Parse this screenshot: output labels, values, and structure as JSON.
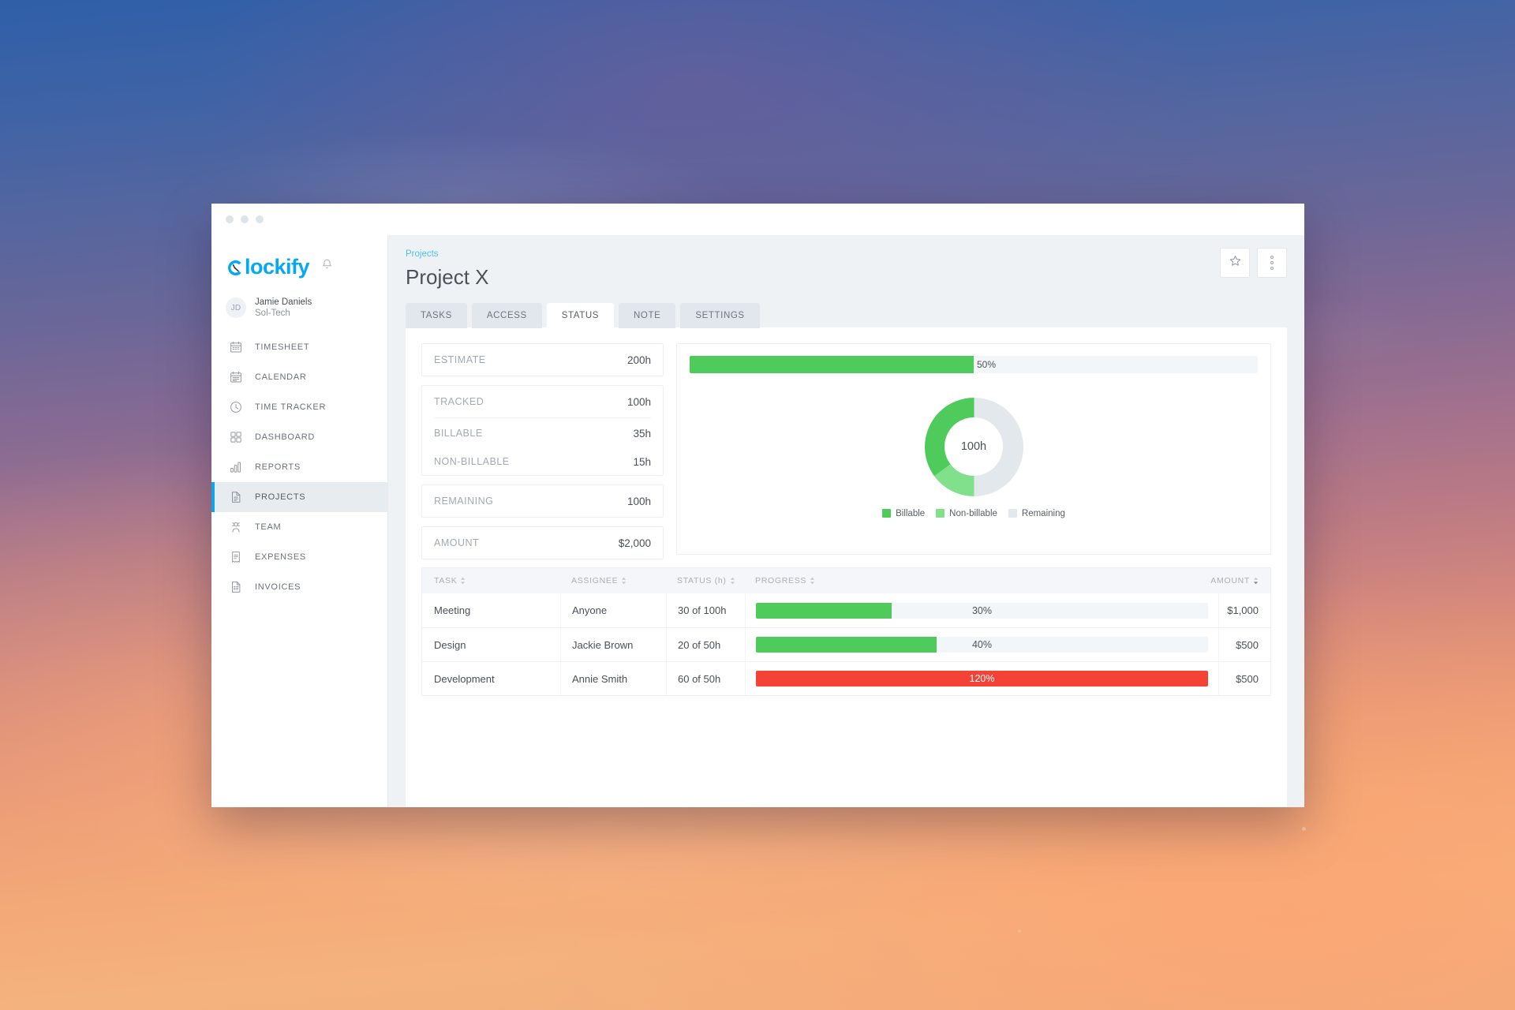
{
  "window": {
    "controls": [
      "close",
      "minimize",
      "maximize"
    ]
  },
  "sidebar": {
    "brand": "lockify",
    "bell_icon": "bell-icon",
    "user": {
      "initials": "JD",
      "name": "Jamie Daniels",
      "org": "Sol-Tech"
    },
    "items": [
      {
        "label": "TIMESHEET",
        "icon": "calendar-grid-icon",
        "active": false
      },
      {
        "label": "CALENDAR",
        "icon": "calendar-lines-icon",
        "active": false
      },
      {
        "label": "TIME TRACKER",
        "icon": "clock-icon",
        "active": false
      },
      {
        "label": "DASHBOARD",
        "icon": "grid-squares-icon",
        "active": false
      },
      {
        "label": "REPORTS",
        "icon": "bar-chart-icon",
        "active": false
      },
      {
        "label": "PROJECTS",
        "icon": "document-icon",
        "active": true
      },
      {
        "label": "TEAM",
        "icon": "people-icon",
        "active": false
      },
      {
        "label": "EXPENSES",
        "icon": "receipt-icon",
        "active": false
      },
      {
        "label": "INVOICES",
        "icon": "invoice-icon",
        "active": false
      }
    ]
  },
  "header": {
    "breadcrumb": "Projects",
    "title": "Project X",
    "favorite_icon": "star-icon",
    "menu_icon": "kebab-menu-icon"
  },
  "tabs": [
    {
      "label": "TASKS",
      "active": false
    },
    {
      "label": "ACCESS",
      "active": false
    },
    {
      "label": "STATUS",
      "active": true
    },
    {
      "label": "NOTE",
      "active": false
    },
    {
      "label": "SETTINGS",
      "active": false
    }
  ],
  "stats": {
    "estimate": {
      "label": "ESTIMATE",
      "value": "200h"
    },
    "tracked": {
      "label": "TRACKED",
      "value": "100h"
    },
    "billable": {
      "label": "BILLABLE",
      "value": "35h"
    },
    "non_billable": {
      "label": "NON-BILLABLE",
      "value": "15h"
    },
    "remaining": {
      "label": "REMAINING",
      "value": "100h"
    },
    "amount": {
      "label": "AMOUNT",
      "value": "$2,000"
    }
  },
  "colors": {
    "green": "#4ecb5a",
    "light_green": "#81e08b",
    "gray": "#e3e8ec",
    "red": "#f44336",
    "accent_blue": "#03a9f4",
    "breadcrumb_blue": "#4fc0f0"
  },
  "chart_data": {
    "type": "pie",
    "title": "",
    "center_label": "100h",
    "overall_progress": {
      "percent": 50,
      "label": "50%"
    },
    "labels": [
      "Billable",
      "Non-billable",
      "Remaining"
    ],
    "values": [
      35,
      15,
      50
    ],
    "units": "h",
    "colors": [
      "#4ecb5a",
      "#81e08b",
      "#e3e8ec"
    ],
    "legend_position": "bottom",
    "total": 200
  },
  "table": {
    "columns": [
      {
        "label": "TASK",
        "sort": "none"
      },
      {
        "label": "ASSIGNEE",
        "sort": "none"
      },
      {
        "label": "STATUS (h)",
        "sort": "none"
      },
      {
        "label": "PROGRESS",
        "sort": "none"
      },
      {
        "label": "AMOUNT",
        "sort": "desc"
      }
    ],
    "rows": [
      {
        "task": "Meeting",
        "assignee": "Anyone",
        "status": "30 of 100h",
        "progress_label": "30%",
        "progress_pct": 30,
        "over": false,
        "amount": "$1,000"
      },
      {
        "task": "Design",
        "assignee": "Jackie Brown",
        "status": "20 of 50h",
        "progress_label": "40%",
        "progress_pct": 40,
        "over": false,
        "amount": "$500"
      },
      {
        "task": "Development",
        "assignee": "Annie Smith",
        "status": "60 of 50h",
        "progress_label": "120%",
        "progress_pct": 100,
        "over": true,
        "amount": "$500"
      }
    ]
  }
}
